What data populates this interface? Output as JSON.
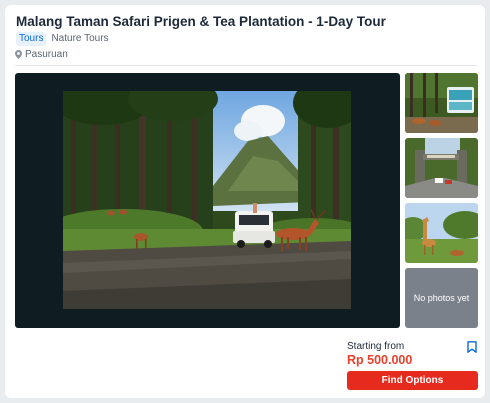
{
  "listing": {
    "title": "Malang Taman Safari Prigen & Tea Plantation - 1-Day Tour",
    "tags": [
      "Tours",
      "Nature Tours"
    ],
    "location": "Pasuruan"
  },
  "gallery": {
    "more_label": "No photos yet"
  },
  "booking": {
    "price_prefix": "Starting from",
    "price": "Rp 500.000",
    "button_label": "Find Options"
  },
  "colors": {
    "accent_blue": "#0b6ad9",
    "price_red": "#e8412c",
    "button_red": "#e62b1e"
  },
  "icons": [
    "location-pin-icon",
    "bookmark-icon"
  ]
}
